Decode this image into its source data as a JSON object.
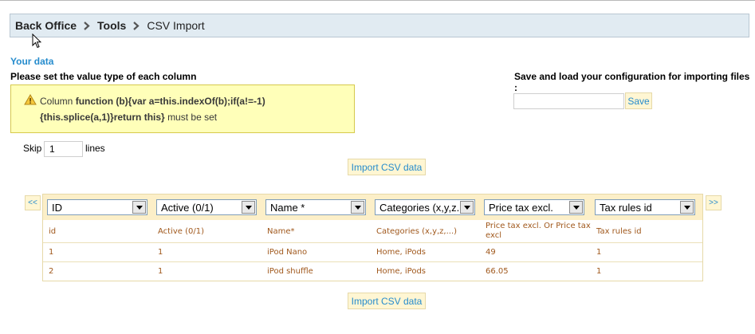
{
  "breadcrumb": {
    "items": [
      "Back Office",
      "Tools",
      "CSV Import"
    ]
  },
  "section": {
    "title": "Your data",
    "instruction": "Please set the value type of each column"
  },
  "warning": {
    "prefix": "Column",
    "code_part1": "function (b){var a=this.indexOf(b);if(a!=-1)",
    "code_part2": "{this.splice(a,1)}return this}",
    "suffix": "must be set"
  },
  "save_config": {
    "title": "Save and load your configuration for importing files :",
    "input_value": "",
    "button_label": "Save"
  },
  "skip": {
    "label": "Skip",
    "value": "1",
    "suffix": "lines"
  },
  "import_button_label": "Import CSV data",
  "nav": {
    "prev": "<<",
    "next": ">>"
  },
  "table": {
    "selects": [
      "ID",
      "Active (0/1)",
      "Name *",
      "Categories (x,y,z...)",
      "Price tax excl.",
      "Tax rules id"
    ],
    "headers": [
      "id",
      "Active (0/1)",
      "Name*",
      "Categories (x,y,z,...)",
      "Price tax excl. Or Price tax excl",
      "Tax rules id"
    ],
    "rows": [
      [
        "1",
        "1",
        "iPod Nano",
        "Home, iPods",
        "49",
        "1"
      ],
      [
        "2",
        "1",
        "iPod shuffle",
        "Home, iPods",
        "66.05",
        "1"
      ]
    ]
  },
  "colors": {
    "link_blue": "#268ccd",
    "cell_brown": "#a0581c",
    "warning_bg": "#ffffb9",
    "header_bg": "#fcefc8",
    "breadcrumb_bg": "#e1ebf2"
  },
  "icons": {
    "breadcrumb_separator": "chevron-right-icon",
    "warning": "warning-icon",
    "dropdown": "dropdown-arrow-icon",
    "cursor": "mouse-cursor-icon"
  }
}
